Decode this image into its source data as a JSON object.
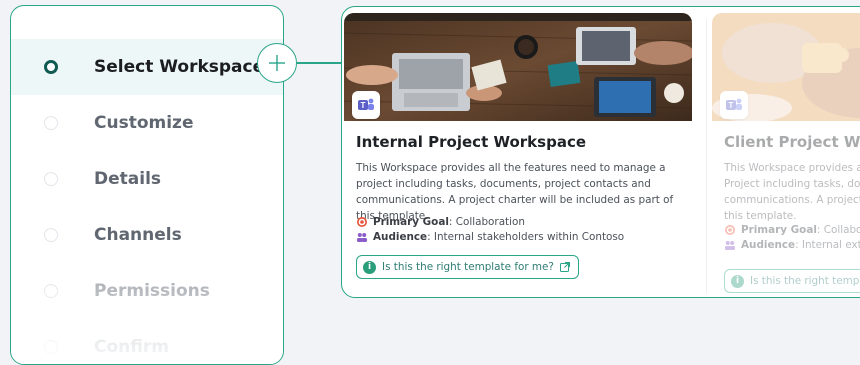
{
  "steps": [
    {
      "label": "Select Workspace",
      "state": "active"
    },
    {
      "label": "Customize",
      "state": "pending"
    },
    {
      "label": "Details",
      "state": "pending"
    },
    {
      "label": "Channels",
      "state": "pending"
    },
    {
      "label": "Permissions",
      "state": "faded"
    },
    {
      "label": "Confirm",
      "state": "faded"
    }
  ],
  "icons": {
    "add": "plus-icon",
    "app_badge": "teams-icon",
    "goal": "target-icon",
    "audience": "people-icon",
    "info": "info-icon",
    "external": "external-link-icon"
  },
  "colors": {
    "accent": "#2aa588",
    "active_marker": "#0f5a52",
    "active_step_bg": "#eef7f7"
  },
  "templates": [
    {
      "title": "Internal Project Workspace",
      "description": "This Workspace provides all the features need to manage a project including tasks, documents, project contacts and communications. A project charter will be included as part of this template.",
      "goal_label": "Primary Goal",
      "goal_value": ": Collaboration",
      "audience_label": "Audience",
      "audience_value": ": Internal stakeholders within Contoso",
      "help_link": "Is this the right template for me?"
    },
    {
      "title": "Client Project Worksp",
      "description": "This Workspace provides all the features need to manage a Project including tasks, documents, client contacts and communications. A project charter will be included as part of this template.",
      "goal_label": "Primary Goal",
      "goal_value": ": Collaboration",
      "audience_label": "Audience",
      "audience_value": ": Internal external",
      "help_link": "Is this the right template for me?"
    }
  ]
}
